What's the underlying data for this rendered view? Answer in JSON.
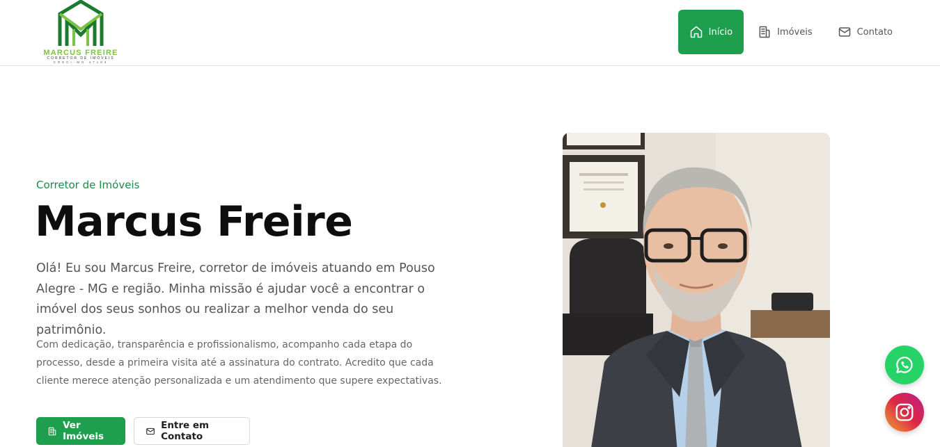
{
  "brand": {
    "name": "MARCUS FREIRE",
    "tagline": "CORRETOR DE IMÓVEIS",
    "creci": "CRECI-MG 47193"
  },
  "nav": {
    "items": [
      {
        "label": "Início",
        "icon": "home-icon",
        "active": true
      },
      {
        "label": "Imóveis",
        "icon": "building-icon",
        "active": false
      },
      {
        "label": "Contato",
        "icon": "mail-icon",
        "active": false
      }
    ]
  },
  "hero": {
    "subtitle": "Corretor de Imóveis",
    "title": "Marcus Freire",
    "lead": "Olá! Eu sou Marcus Freire, corretor de imóveis atuando em Pouso Alegre - MG e região. Minha missão é ajudar você a encontrar o imóvel dos seus sonhos ou realizar a melhor venda do seu patrimônio.",
    "body": "Com dedicação, transparência e profissionalismo, acompanho cada etapa do processo, desde a primeira visita até a assinatura do contrato. Acredito que cada cliente merece atenção personalizada e um atendimento que supere expectativas.",
    "primary_button": "Ver Imóveis",
    "secondary_button": "Entre em Contato"
  },
  "colors": {
    "accent": "#1d9f4e",
    "logo_dark_green": "#1b7a2e",
    "logo_light_green": "#7cc243",
    "whatsapp": "#25d366"
  },
  "floating": {
    "whatsapp_icon": "whatsapp-icon",
    "instagram_icon": "instagram-icon"
  }
}
